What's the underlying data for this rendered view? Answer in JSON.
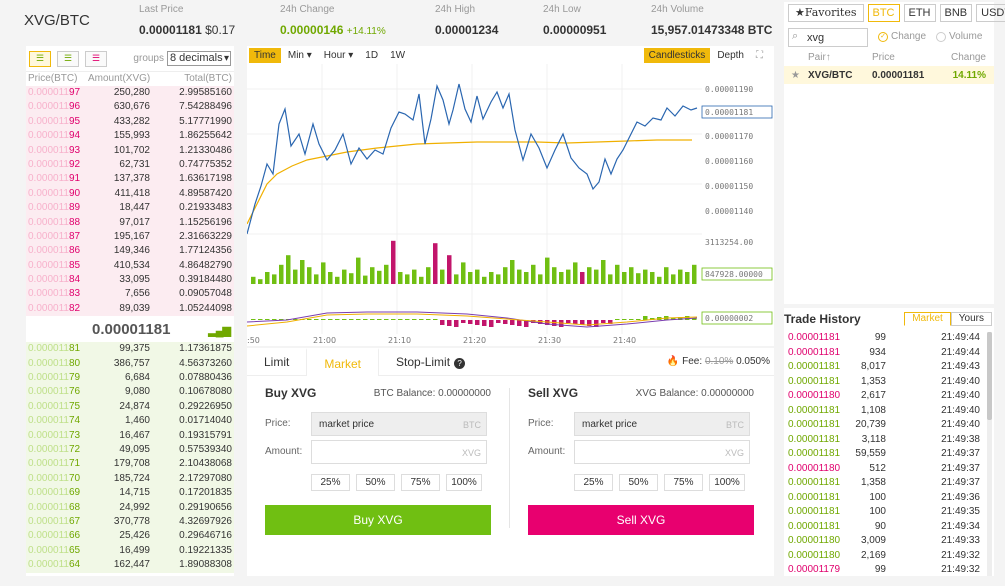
{
  "header": {
    "pair": "XVG/BTC",
    "stats": [
      {
        "label": "Last Price",
        "value": "0.00001181",
        "extra": "$0.17"
      },
      {
        "label": "24h Change",
        "value": "0.00000146",
        "extra": "+14.11%"
      },
      {
        "label": "24h High",
        "value": "0.00001234",
        "extra": ""
      },
      {
        "label": "24h Low",
        "value": "0.00000951",
        "extra": ""
      },
      {
        "label": "24h Volume",
        "value": "15,957.01473348 BTC",
        "extra": ""
      }
    ]
  },
  "orderbook": {
    "groups_label": "groups",
    "groups_value": "8 decimals",
    "col_price": "Price(BTC)",
    "col_amount": "Amount(XVG)",
    "col_total": "Total(BTC)",
    "asks": [
      {
        "pre": "0.000011",
        "suf": "97",
        "amount": "250,280",
        "total": "2.99585160"
      },
      {
        "pre": "0.000011",
        "suf": "96",
        "amount": "630,676",
        "total": "7.54288496"
      },
      {
        "pre": "0.000011",
        "suf": "95",
        "amount": "433,282",
        "total": "5.17771990"
      },
      {
        "pre": "0.000011",
        "suf": "94",
        "amount": "155,993",
        "total": "1.86255642"
      },
      {
        "pre": "0.000011",
        "suf": "93",
        "amount": "101,702",
        "total": "1.21330486"
      },
      {
        "pre": "0.000011",
        "suf": "92",
        "amount": "62,731",
        "total": "0.74775352"
      },
      {
        "pre": "0.000011",
        "suf": "91",
        "amount": "137,378",
        "total": "1.63617198"
      },
      {
        "pre": "0.000011",
        "suf": "90",
        "amount": "411,418",
        "total": "4.89587420"
      },
      {
        "pre": "0.000011",
        "suf": "89",
        "amount": "18,447",
        "total": "0.21933483"
      },
      {
        "pre": "0.000011",
        "suf": "88",
        "amount": "97,017",
        "total": "1.15256196"
      },
      {
        "pre": "0.000011",
        "suf": "87",
        "amount": "195,167",
        "total": "2.31663229"
      },
      {
        "pre": "0.000011",
        "suf": "86",
        "amount": "149,346",
        "total": "1.77124356"
      },
      {
        "pre": "0.000011",
        "suf": "85",
        "amount": "410,534",
        "total": "4.86482790"
      },
      {
        "pre": "0.000011",
        "suf": "84",
        "amount": "33,095",
        "total": "0.39184480"
      },
      {
        "pre": "0.000011",
        "suf": "83",
        "amount": "7,656",
        "total": "0.09057048"
      },
      {
        "pre": "0.000011",
        "suf": "82",
        "amount": "89,039",
        "total": "1.05244098"
      }
    ],
    "mid_price": "0.00001181",
    "bids": [
      {
        "pre": "0.000011",
        "suf": "81",
        "amount": "99,375",
        "total": "1.17361875"
      },
      {
        "pre": "0.000011",
        "suf": "80",
        "amount": "386,757",
        "total": "4.56373260"
      },
      {
        "pre": "0.000011",
        "suf": "79",
        "amount": "6,684",
        "total": "0.07880436"
      },
      {
        "pre": "0.000011",
        "suf": "76",
        "amount": "9,080",
        "total": "0.10678080"
      },
      {
        "pre": "0.000011",
        "suf": "75",
        "amount": "24,874",
        "total": "0.29226950"
      },
      {
        "pre": "0.000011",
        "suf": "74",
        "amount": "1,460",
        "total": "0.01714040"
      },
      {
        "pre": "0.000011",
        "suf": "73",
        "amount": "16,467",
        "total": "0.19315791"
      },
      {
        "pre": "0.000011",
        "suf": "72",
        "amount": "49,095",
        "total": "0.57539340"
      },
      {
        "pre": "0.000011",
        "suf": "71",
        "amount": "179,708",
        "total": "2.10438068"
      },
      {
        "pre": "0.000011",
        "suf": "70",
        "amount": "185,724",
        "total": "2.17297080"
      },
      {
        "pre": "0.000011",
        "suf": "69",
        "amount": "14,715",
        "total": "0.17201835"
      },
      {
        "pre": "0.000011",
        "suf": "68",
        "amount": "24,992",
        "total": "0.29190656"
      },
      {
        "pre": "0.000011",
        "suf": "67",
        "amount": "370,778",
        "total": "4.32697926"
      },
      {
        "pre": "0.000011",
        "suf": "66",
        "amount": "25,426",
        "total": "0.29646716"
      },
      {
        "pre": "0.000011",
        "suf": "65",
        "amount": "16,499",
        "total": "0.19221335"
      },
      {
        "pre": "0.000011",
        "suf": "64",
        "amount": "162,447",
        "total": "1.89088308"
      }
    ]
  },
  "chart_toolbar": {
    "time": "Time",
    "min": "Min ▾",
    "hour": "Hour ▾",
    "d1": "1D",
    "w1": "1W",
    "candlesticks": "Candlesticks",
    "depth": "Depth",
    "fullscreen_glyph": "⛶"
  },
  "chart_axis": {
    "price_ticks": [
      "0.00001190",
      "0.00001181",
      "0.00001170",
      "0.00001160",
      "0.00001150",
      "0.00001140"
    ],
    "volume_ticks": [
      "3113254.00",
      "847928.00000"
    ],
    "macd_tick": "0.00000002",
    "time_ticks": [
      ":50",
      "21:00",
      "21:10",
      "21:20",
      "21:30",
      "21:40"
    ]
  },
  "trade_form": {
    "tabs": [
      "Limit",
      "Market",
      "Stop-Limit"
    ],
    "info_glyph": "?",
    "fee_label": "Fee:",
    "fee_old": "0.10%",
    "fee_new": "0.050%",
    "buy": {
      "title": "Buy XVG",
      "balance": "BTC Balance: 0.00000000",
      "price_label": "Price:",
      "price_value": "market price",
      "price_unit": "BTC",
      "amount_label": "Amount:",
      "amount_unit": "XVG",
      "pcts": [
        "25%",
        "50%",
        "75%",
        "100%"
      ],
      "button": "Buy XVG"
    },
    "sell": {
      "title": "Sell XVG",
      "balance": "XVG Balance: 0.00000000",
      "price_label": "Price:",
      "price_value": "market price",
      "price_unit": "BTC",
      "amount_label": "Amount:",
      "amount_unit": "XVG",
      "pcts": [
        "25%",
        "50%",
        "75%",
        "100%"
      ],
      "button": "Sell XVG"
    }
  },
  "market": {
    "tabs": [
      "★Favorites",
      "BTC",
      "ETH",
      "BNB",
      "USDT"
    ],
    "search_value": "xvg",
    "radio_change": "Change",
    "radio_volume": "Volume",
    "col_pair": "Pair↑",
    "col_price": "Price",
    "col_change": "Change",
    "row": {
      "pair": "XVG/BTC",
      "price": "0.00001181",
      "change": "14.11%"
    }
  },
  "history": {
    "title": "Trade History",
    "tabs": [
      "Market",
      "Yours"
    ],
    "rows": [
      {
        "price": "0.00001181",
        "amount": "99",
        "time": "21:49:44",
        "side": "sell"
      },
      {
        "price": "0.00001181",
        "amount": "934",
        "time": "21:49:44",
        "side": "sell"
      },
      {
        "price": "0.00001181",
        "amount": "8,017",
        "time": "21:49:43",
        "side": "buy"
      },
      {
        "price": "0.00001181",
        "amount": "1,353",
        "time": "21:49:40",
        "side": "buy"
      },
      {
        "price": "0.00001180",
        "amount": "2,617",
        "time": "21:49:40",
        "side": "sell"
      },
      {
        "price": "0.00001181",
        "amount": "1,108",
        "time": "21:49:40",
        "side": "buy"
      },
      {
        "price": "0.00001181",
        "amount": "20,739",
        "time": "21:49:40",
        "side": "buy"
      },
      {
        "price": "0.00001181",
        "amount": "3,118",
        "time": "21:49:38",
        "side": "buy"
      },
      {
        "price": "0.00001181",
        "amount": "59,559",
        "time": "21:49:37",
        "side": "buy"
      },
      {
        "price": "0.00001180",
        "amount": "512",
        "time": "21:49:37",
        "side": "sell"
      },
      {
        "price": "0.00001181",
        "amount": "1,358",
        "time": "21:49:37",
        "side": "buy"
      },
      {
        "price": "0.00001181",
        "amount": "100",
        "time": "21:49:36",
        "side": "buy"
      },
      {
        "price": "0.00001181",
        "amount": "100",
        "time": "21:49:35",
        "side": "buy"
      },
      {
        "price": "0.00001181",
        "amount": "90",
        "time": "21:49:34",
        "side": "buy"
      },
      {
        "price": "0.00001180",
        "amount": "3,009",
        "time": "21:49:33",
        "side": "buy"
      },
      {
        "price": "0.00001180",
        "amount": "2,169",
        "time": "21:49:32",
        "side": "buy"
      },
      {
        "price": "0.00001179",
        "amount": "99",
        "time": "21:49:32",
        "side": "sell"
      }
    ]
  },
  "colors": {
    "accent": "#f0b90b",
    "buy": "#70bf12",
    "sell": "#e8006f",
    "price_line": "#2a66b0",
    "ma_line": "#f0b000",
    "macd_line": "#7a3db0"
  }
}
